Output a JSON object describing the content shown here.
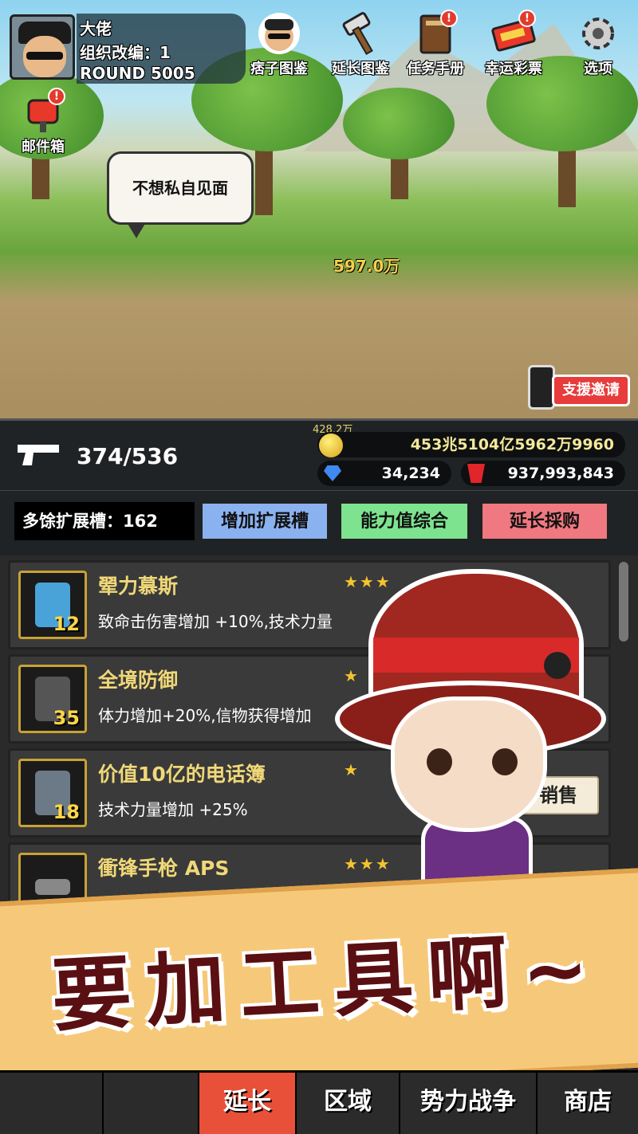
{
  "player": {
    "name": "大佬",
    "reorg_label": "组织改编：1",
    "round_label": "ROUND 5005"
  },
  "top_icons": [
    {
      "label": "痞子图鉴",
      "icon": "gangster-face-icon",
      "badge": ""
    },
    {
      "label": "延长图鉴",
      "icon": "hammer-icon",
      "badge": ""
    },
    {
      "label": "任务手册",
      "icon": "book-icon",
      "badge": "!"
    },
    {
      "label": "幸运彩票",
      "icon": "lottery-ticket-icon",
      "badge": "!"
    },
    {
      "label": "选项",
      "icon": "gear-icon",
      "badge": ""
    }
  ],
  "mailbox": {
    "label": "邮件箱",
    "badge": "!"
  },
  "scene": {
    "speech": "不想私自见面",
    "floating_damage": "597.0万",
    "invite_button": "支援邀请"
  },
  "resources": {
    "ammo": "374/536",
    "gold_rate": "428.2万",
    "gold": "453兆5104亿5962万9960",
    "gems": "34,234",
    "rubies": "937,993,843"
  },
  "slots": {
    "remaining_label": "多馀扩展槽：162",
    "expand_button": "增加扩展槽",
    "ability_button": "能力值综合",
    "purchase_button": "延长採购"
  },
  "items": [
    {
      "name": "翚力慕斯",
      "level": "12",
      "stars": "★★★",
      "desc": "致命击伤害增加 +10%,技术力量",
      "sell": ""
    },
    {
      "name": "全境防御",
      "level": "35",
      "stars": "★",
      "desc": "体力增加+20%,信物获得增加",
      "sell": ""
    },
    {
      "name": "价值10亿的电话簿",
      "level": "18",
      "stars": "★",
      "desc": "技术力量增加 +25%",
      "sell": "销售"
    },
    {
      "name": "衝锋手枪 APS",
      "level": "",
      "stars": "★★★",
      "desc": "",
      "sell": ""
    }
  ],
  "banner": {
    "text": "要加工具啊~"
  },
  "nav": {
    "tabs": [
      "",
      "延长",
      "区域",
      "势力战争",
      "商店"
    ],
    "active_index": 1
  },
  "colors": {
    "accent_red": "#e8503a",
    "gold_text": "#f0d878",
    "banner_bg": "#f6c97a",
    "banner_text": "#5a0f12"
  }
}
